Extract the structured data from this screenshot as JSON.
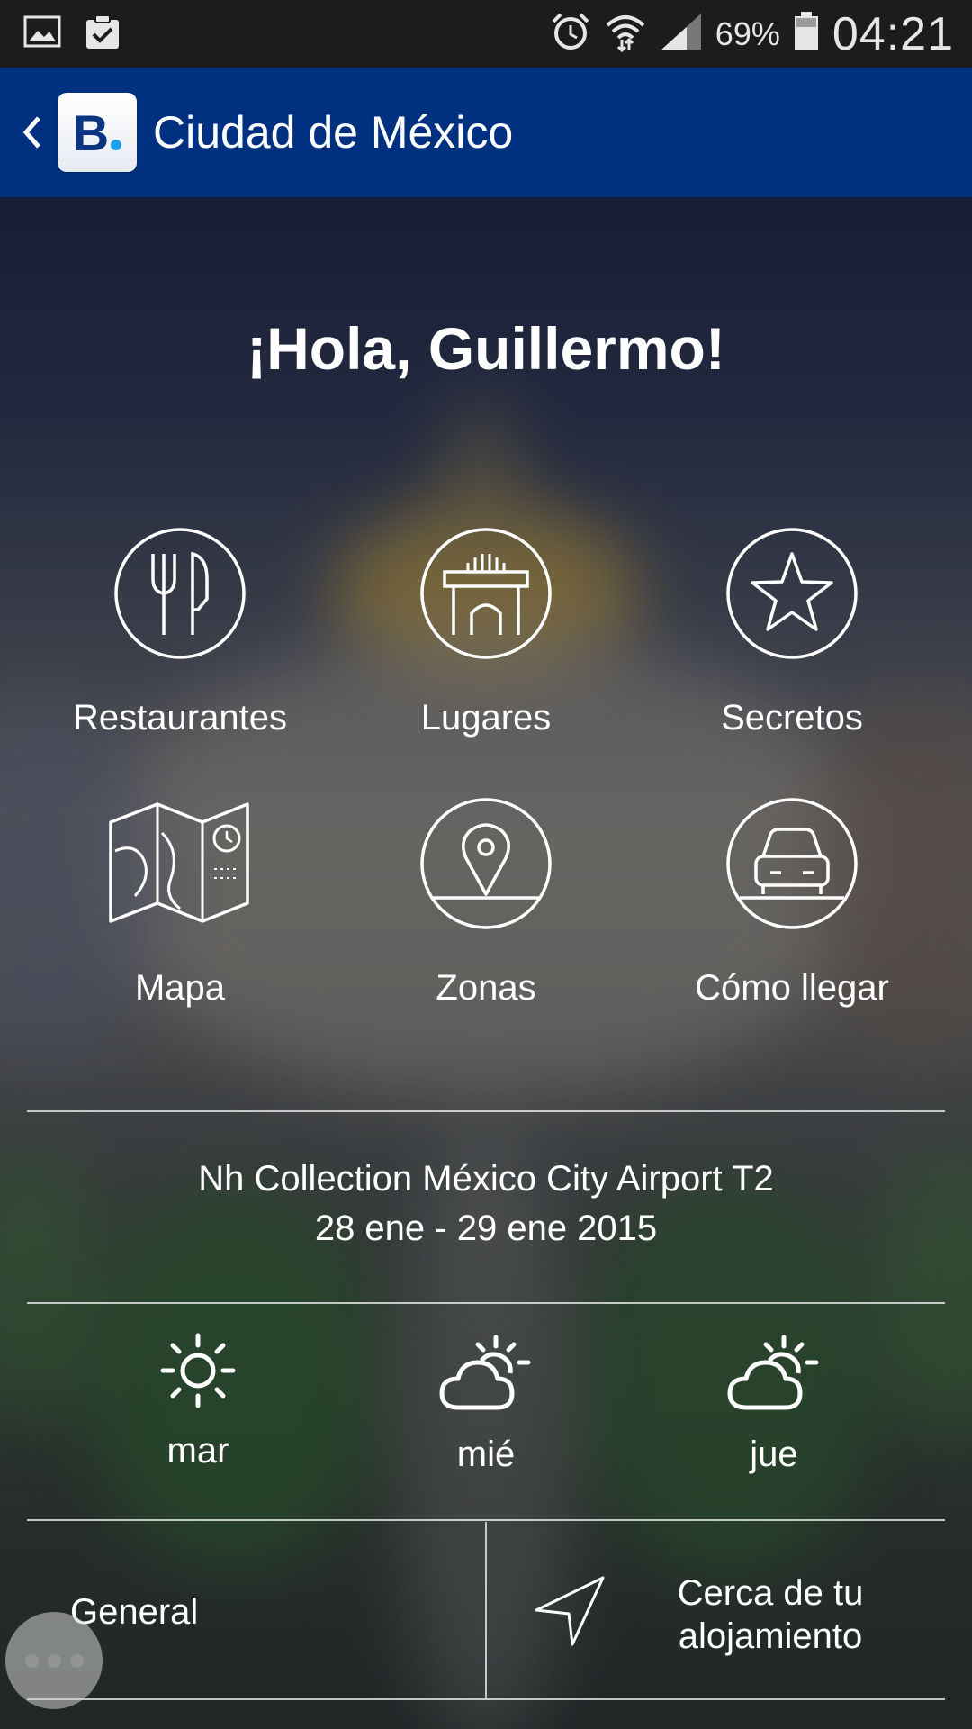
{
  "status_bar": {
    "battery_percent": "69%",
    "time": "04:21",
    "icons": [
      "gallery-icon",
      "clipboard-check-icon",
      "alarm-icon",
      "wifi-icon",
      "cellular-signal-icon",
      "battery-icon"
    ]
  },
  "app_bar": {
    "logo_text": "B",
    "title": "Ciudad de México",
    "brand_color": "#003181",
    "logo_dot_color": "#1aa1e6"
  },
  "greeting": "¡Hola, Guillermo!",
  "menu": [
    {
      "label": "Restaurantes",
      "icon": "fork-knife-icon"
    },
    {
      "label": "Lugares",
      "icon": "monument-icon"
    },
    {
      "label": "Secretos",
      "icon": "star-icon"
    },
    {
      "label": "Mapa",
      "icon": "map-icon"
    },
    {
      "label": "Zonas",
      "icon": "location-pin-icon"
    },
    {
      "label": "Cómo llegar",
      "icon": "car-icon"
    }
  ],
  "booking": {
    "hotel": "Nh Collection México City Airport T2",
    "dates": "28 ene - 29 ene 2015"
  },
  "weather": [
    {
      "day": "mar",
      "icon": "sun-icon"
    },
    {
      "day": "mié",
      "icon": "partly-cloudy-icon"
    },
    {
      "day": "jue",
      "icon": "partly-cloudy-icon"
    }
  ],
  "tabs": {
    "general": "General",
    "nearby": "Cerca de tu alojamiento"
  }
}
